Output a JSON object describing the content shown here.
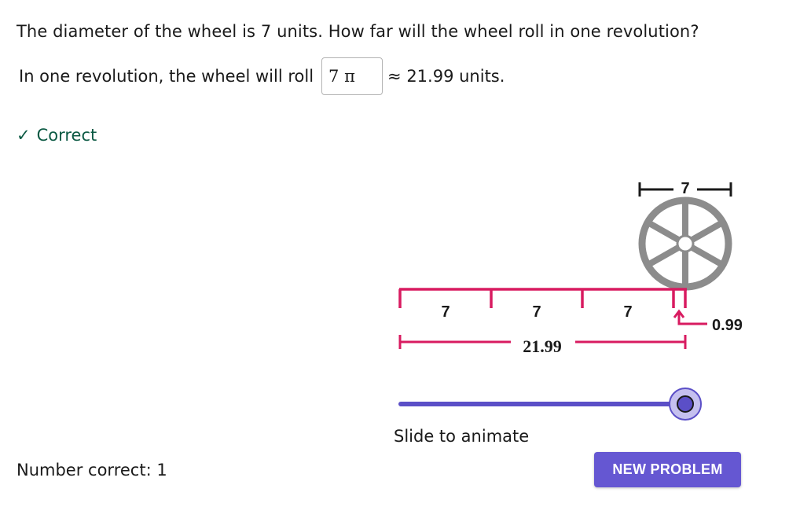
{
  "question": "The diameter of the wheel is 7 units. How far will the wheel roll in one revolution?",
  "answer": {
    "prefix": "In one revolution, the wheel will roll",
    "value": "7 π",
    "suffix": "≈ 21.99 units."
  },
  "feedback": {
    "check": "✓",
    "text": "Correct"
  },
  "score_label": "Number correct: 1",
  "diagram": {
    "diameter_label": "7",
    "segment_labels": [
      "7",
      "7",
      "7"
    ],
    "remainder_label": "0.99",
    "total_label": "21.99",
    "accent_color": "#d81b60",
    "wheel_color": "#8c8c8c"
  },
  "slider": {
    "value": 1.0,
    "color": "#5b4fc7"
  },
  "slider_caption": "Slide to animate",
  "new_problem_button": "NEW PROBLEM"
}
